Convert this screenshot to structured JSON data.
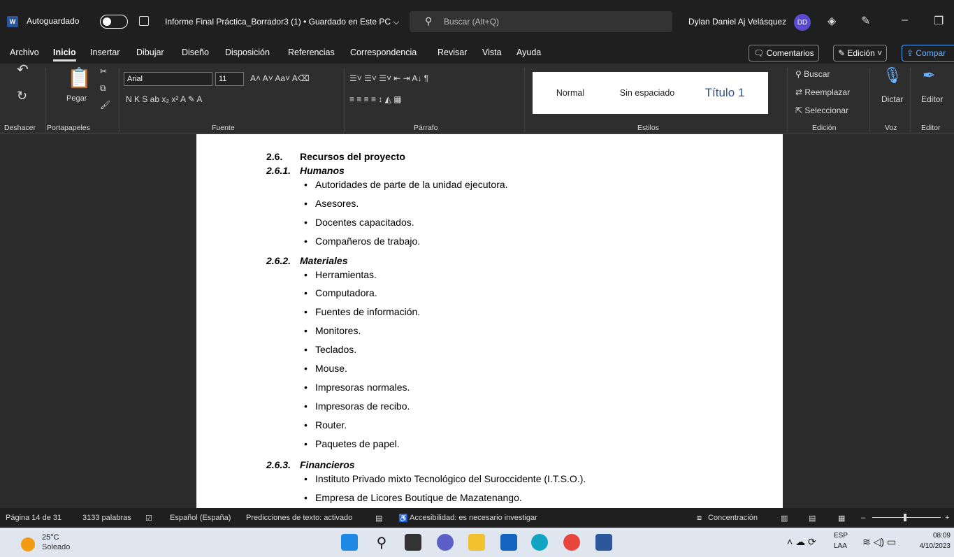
{
  "titlebar": {
    "autosave_label": "Autoguardado",
    "doc_title": "Informe Final Práctica_Borrador3 (1) • Guardado en Este PC ⌵",
    "search_placeholder": "Buscar (Alt+Q)",
    "user_name": "Dylan Daniel Aj Velásquez",
    "user_initials": "DD"
  },
  "menu": {
    "items": [
      "Archivo",
      "Inicio",
      "Insertar",
      "Dibujar",
      "Diseño",
      "Disposición",
      "Referencias",
      "Correspondencia",
      "Revisar",
      "Vista",
      "Ayuda"
    ],
    "comments": "Comentarios",
    "editing": "Edición",
    "share": "Compar"
  },
  "ribbon": {
    "font_name": "Arial",
    "font_size": "11",
    "paste_label": "Pegar",
    "groups": {
      "undo": "Deshacer",
      "clipboard": "Portapapeles",
      "font": "Fuente",
      "paragraph": "Párrafo",
      "styles": "Estilos",
      "editing": "Edición",
      "voice": "Voz",
      "editor": "Editor"
    },
    "styles": [
      "Normal",
      "Sin espaciado",
      "Título 1"
    ],
    "edit_actions": [
      "Buscar",
      "Reemplazar",
      "Seleccionar"
    ],
    "dictate": "Dictar",
    "editor": "Editor"
  },
  "document": {
    "section_num": "2.6.",
    "section_title": "Recursos del proyecto",
    "sub1": {
      "num": "2.6.1.",
      "title": "Humanos",
      "items": [
        "Autoridades de parte de la unidad ejecutora.",
        "Asesores.",
        "Docentes capacitados.",
        "Compañeros de trabajo."
      ]
    },
    "sub2": {
      "num": "2.6.2.",
      "title": "Materiales",
      "items": [
        "Herramientas.",
        "Computadora.",
        "Fuentes de información.",
        "Monitores.",
        "Teclados.",
        "Mouse.",
        "Impresoras normales.",
        "Impresoras de recibo.",
        "Router.",
        "Paquetes de papel."
      ]
    },
    "sub3": {
      "num": "2.6.3.",
      "title": "Financieros",
      "items": [
        "Instituto Privado mixto Tecnológico del Suroccidente (I.T.S.O.).",
        "Empresa de Licores Boutique de Mazatenango."
      ]
    }
  },
  "status": {
    "page": "Página 14 de 31",
    "words": "3133 palabras",
    "language": "Español (España)",
    "predictions": "Predicciones de texto: activado",
    "accessibility": "Accesibilidad: es necesario investigar",
    "focus": "Concentración"
  },
  "taskbar": {
    "temp": "25°C",
    "weather": "Soleado",
    "lang1": "ESP",
    "lang2": "LAA",
    "time": "08:09",
    "date": "4/10/2023"
  }
}
